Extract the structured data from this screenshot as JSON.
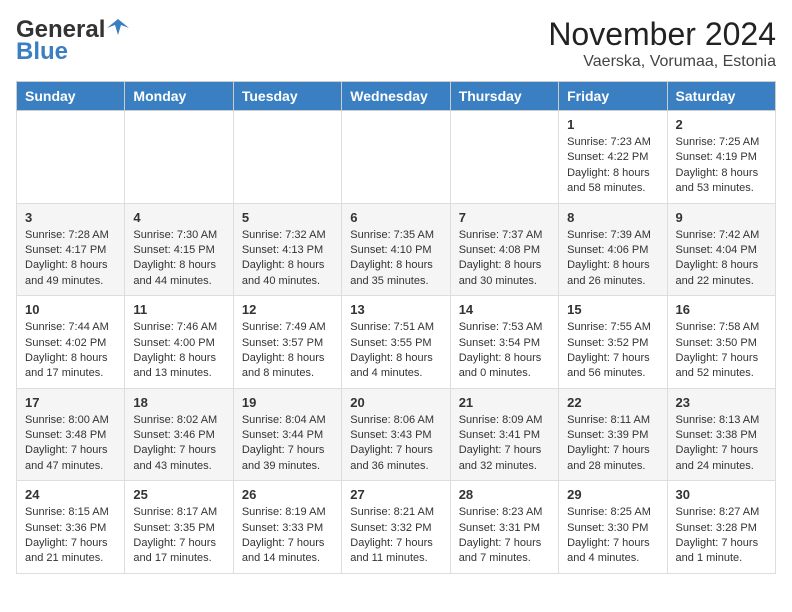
{
  "logo": {
    "general": "General",
    "blue": "Blue"
  },
  "title": {
    "month_year": "November 2024",
    "location": "Vaerska, Vorumaa, Estonia"
  },
  "headers": [
    "Sunday",
    "Monday",
    "Tuesday",
    "Wednesday",
    "Thursday",
    "Friday",
    "Saturday"
  ],
  "weeks": [
    [
      {
        "day": "",
        "info": ""
      },
      {
        "day": "",
        "info": ""
      },
      {
        "day": "",
        "info": ""
      },
      {
        "day": "",
        "info": ""
      },
      {
        "day": "",
        "info": ""
      },
      {
        "day": "1",
        "info": "Sunrise: 7:23 AM\nSunset: 4:22 PM\nDaylight: 8 hours\nand 58 minutes."
      },
      {
        "day": "2",
        "info": "Sunrise: 7:25 AM\nSunset: 4:19 PM\nDaylight: 8 hours\nand 53 minutes."
      }
    ],
    [
      {
        "day": "3",
        "info": "Sunrise: 7:28 AM\nSunset: 4:17 PM\nDaylight: 8 hours\nand 49 minutes."
      },
      {
        "day": "4",
        "info": "Sunrise: 7:30 AM\nSunset: 4:15 PM\nDaylight: 8 hours\nand 44 minutes."
      },
      {
        "day": "5",
        "info": "Sunrise: 7:32 AM\nSunset: 4:13 PM\nDaylight: 8 hours\nand 40 minutes."
      },
      {
        "day": "6",
        "info": "Sunrise: 7:35 AM\nSunset: 4:10 PM\nDaylight: 8 hours\nand 35 minutes."
      },
      {
        "day": "7",
        "info": "Sunrise: 7:37 AM\nSunset: 4:08 PM\nDaylight: 8 hours\nand 30 minutes."
      },
      {
        "day": "8",
        "info": "Sunrise: 7:39 AM\nSunset: 4:06 PM\nDaylight: 8 hours\nand 26 minutes."
      },
      {
        "day": "9",
        "info": "Sunrise: 7:42 AM\nSunset: 4:04 PM\nDaylight: 8 hours\nand 22 minutes."
      }
    ],
    [
      {
        "day": "10",
        "info": "Sunrise: 7:44 AM\nSunset: 4:02 PM\nDaylight: 8 hours\nand 17 minutes."
      },
      {
        "day": "11",
        "info": "Sunrise: 7:46 AM\nSunset: 4:00 PM\nDaylight: 8 hours\nand 13 minutes."
      },
      {
        "day": "12",
        "info": "Sunrise: 7:49 AM\nSunset: 3:57 PM\nDaylight: 8 hours\nand 8 minutes."
      },
      {
        "day": "13",
        "info": "Sunrise: 7:51 AM\nSunset: 3:55 PM\nDaylight: 8 hours\nand 4 minutes."
      },
      {
        "day": "14",
        "info": "Sunrise: 7:53 AM\nSunset: 3:54 PM\nDaylight: 8 hours\nand 0 minutes."
      },
      {
        "day": "15",
        "info": "Sunrise: 7:55 AM\nSunset: 3:52 PM\nDaylight: 7 hours\nand 56 minutes."
      },
      {
        "day": "16",
        "info": "Sunrise: 7:58 AM\nSunset: 3:50 PM\nDaylight: 7 hours\nand 52 minutes."
      }
    ],
    [
      {
        "day": "17",
        "info": "Sunrise: 8:00 AM\nSunset: 3:48 PM\nDaylight: 7 hours\nand 47 minutes."
      },
      {
        "day": "18",
        "info": "Sunrise: 8:02 AM\nSunset: 3:46 PM\nDaylight: 7 hours\nand 43 minutes."
      },
      {
        "day": "19",
        "info": "Sunrise: 8:04 AM\nSunset: 3:44 PM\nDaylight: 7 hours\nand 39 minutes."
      },
      {
        "day": "20",
        "info": "Sunrise: 8:06 AM\nSunset: 3:43 PM\nDaylight: 7 hours\nand 36 minutes."
      },
      {
        "day": "21",
        "info": "Sunrise: 8:09 AM\nSunset: 3:41 PM\nDaylight: 7 hours\nand 32 minutes."
      },
      {
        "day": "22",
        "info": "Sunrise: 8:11 AM\nSunset: 3:39 PM\nDaylight: 7 hours\nand 28 minutes."
      },
      {
        "day": "23",
        "info": "Sunrise: 8:13 AM\nSunset: 3:38 PM\nDaylight: 7 hours\nand 24 minutes."
      }
    ],
    [
      {
        "day": "24",
        "info": "Sunrise: 8:15 AM\nSunset: 3:36 PM\nDaylight: 7 hours\nand 21 minutes."
      },
      {
        "day": "25",
        "info": "Sunrise: 8:17 AM\nSunset: 3:35 PM\nDaylight: 7 hours\nand 17 minutes."
      },
      {
        "day": "26",
        "info": "Sunrise: 8:19 AM\nSunset: 3:33 PM\nDaylight: 7 hours\nand 14 minutes."
      },
      {
        "day": "27",
        "info": "Sunrise: 8:21 AM\nSunset: 3:32 PM\nDaylight: 7 hours\nand 11 minutes."
      },
      {
        "day": "28",
        "info": "Sunrise: 8:23 AM\nSunset: 3:31 PM\nDaylight: 7 hours\nand 7 minutes."
      },
      {
        "day": "29",
        "info": "Sunrise: 8:25 AM\nSunset: 3:30 PM\nDaylight: 7 hours\nand 4 minutes."
      },
      {
        "day": "30",
        "info": "Sunrise: 8:27 AM\nSunset: 3:28 PM\nDaylight: 7 hours\nand 1 minute."
      }
    ]
  ]
}
